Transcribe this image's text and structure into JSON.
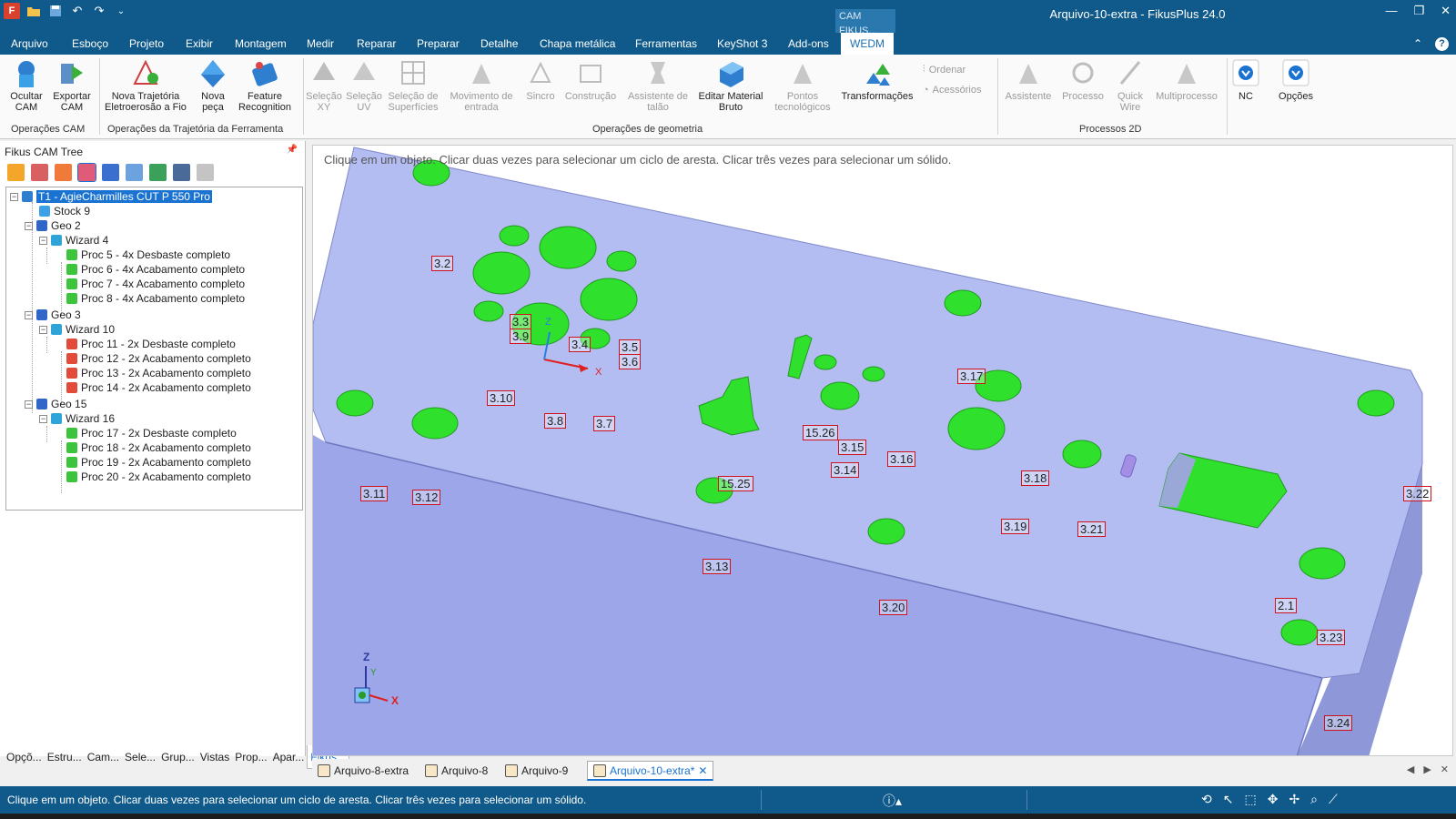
{
  "app": {
    "window_title": "Arquivo-10-extra - FikusPlus 24.0",
    "context_tab_title": "CAM FIKUS...",
    "colors": {
      "titlebar": "#0f5a8a",
      "part_face": "#b9c3f0",
      "feature_green": "#2fe02c",
      "label_border": "#d0121b",
      "selection": "#1a73d1"
    }
  },
  "quick_access": {
    "icons": [
      "app-logo-icon",
      "open-folder-icon",
      "save-icon",
      "undo-icon",
      "redo-icon",
      "customize-icon"
    ],
    "app_logo_text": "F"
  },
  "menu": {
    "items": [
      "Arquivo",
      "Esboço",
      "Projeto",
      "Exibir",
      "Montagem",
      "Medir",
      "Reparar",
      "Preparar",
      "Detalhe",
      "Chapa metálica",
      "Ferramentas",
      "KeyShot 3",
      "Add-ons",
      "WEDM"
    ],
    "active": "WEDM",
    "help": "?"
  },
  "ribbon": {
    "buttons": [
      {
        "id": "ocultar",
        "label": "Ocultar CAM",
        "icon": "hide-cam-icon",
        "enabled": true
      },
      {
        "id": "exportar",
        "label": "Exportar CAM",
        "icon": "export-cam-icon",
        "enabled": true
      },
      {
        "id": "nova-trajetoria",
        "label": "Nova Trajetória Eletroerosão a Fio",
        "icon": "new-toolpath-icon",
        "enabled": true
      },
      {
        "id": "nova-peca",
        "label": "Nova peça",
        "icon": "new-part-icon",
        "enabled": true
      },
      {
        "id": "feature",
        "label": "Feature Recognition",
        "icon": "feature-recognition-icon",
        "enabled": true
      },
      {
        "id": "selecao-xy",
        "label": "Seleção XY",
        "icon": "select-xy-icon",
        "enabled": false
      },
      {
        "id": "selecao-uv",
        "label": "Seleção UV",
        "icon": "select-uv-icon",
        "enabled": false
      },
      {
        "id": "selecao-sup",
        "label": "Seleção de Superfícies",
        "icon": "select-surfaces-icon",
        "enabled": false
      },
      {
        "id": "movimento",
        "label": "Movimento de entrada",
        "icon": "lead-in-icon",
        "enabled": false
      },
      {
        "id": "sincro",
        "label": "Sincro",
        "icon": "sync-icon",
        "enabled": false
      },
      {
        "id": "construcao",
        "label": "Construção",
        "icon": "construction-icon",
        "enabled": false
      },
      {
        "id": "assistente-talao",
        "label": "Assistente de talão",
        "icon": "slug-assistant-icon",
        "enabled": false
      },
      {
        "id": "editar-material",
        "label": "Editar Material Bruto",
        "icon": "edit-stock-icon",
        "enabled": true
      },
      {
        "id": "pontos",
        "label": "Pontos tecnológicos",
        "icon": "tech-points-icon",
        "enabled": false
      },
      {
        "id": "transformacoes",
        "label": "Transformações",
        "icon": "transformations-icon",
        "enabled": true
      },
      {
        "id": "assistente",
        "label": "Assistente",
        "icon": "assistant-icon",
        "enabled": false
      },
      {
        "id": "processo",
        "label": "Processo",
        "icon": "process-icon",
        "enabled": false
      },
      {
        "id": "quick-wire",
        "label": "Quick Wire",
        "icon": "quick-wire-icon",
        "enabled": false
      },
      {
        "id": "multiprocesso",
        "label": "Multiprocesso",
        "icon": "multiprocess-icon",
        "enabled": false
      },
      {
        "id": "nc",
        "label": "NC",
        "icon": "nc-download-icon",
        "enabled": true
      },
      {
        "id": "opcoes",
        "label": "Opções",
        "icon": "options-download-icon",
        "enabled": true
      }
    ],
    "small_buttons": {
      "ordenar": "Ordenar",
      "acessorios": "Acessórios"
    },
    "groups": {
      "operacoes_cam": "Operações CAM",
      "operacoes_trajetoria": "Operações da Trajetória da Ferramenta",
      "operacoes_geometria": "Operações de geometria",
      "processos_2d": "Processos 2D"
    }
  },
  "left_panel": {
    "title": "Fikus CAM Tree",
    "tools": [
      "machine-icon",
      "toolpath-icon",
      "stock-box-icon",
      "geometry-box-icon",
      "wizard-icon",
      "copy-icon",
      "layers-icon",
      "filter-icon",
      "settings-disabled-icon"
    ],
    "tree": {
      "root": "T1 - AgieCharmilles CUT P 550 Pro",
      "stock": "Stock 9",
      "geos": [
        {
          "name": "Geo 2",
          "wizard": "Wizard 4",
          "procs": [
            "Proc 5 - 4x Desbaste completo",
            "Proc 6 - 4x Acabamento completo",
            "Proc 7 - 4x Acabamento completo",
            "Proc 8 - 4x Acabamento completo"
          ]
        },
        {
          "name": "Geo 3",
          "wizard": "Wizard 10",
          "procs": [
            "Proc 11 - 2x Desbaste completo",
            "Proc 12 - 2x Acabamento completo",
            "Proc 13 - 2x Acabamento completo",
            "Proc 14 - 2x Acabamento completo"
          ]
        },
        {
          "name": "Geo 15",
          "wizard": "Wizard 16",
          "procs": [
            "Proc 17 - 2x Desbaste completo",
            "Proc 18 - 2x Acabamento completo",
            "Proc 19 - 2x Acabamento completo",
            "Proc 20 - 2x Acabamento completo"
          ]
        }
      ]
    },
    "tabs": [
      "Opçõ...",
      "Estru...",
      "Cam...",
      "Sele...",
      "Grup...",
      "Vistas",
      "Prop...",
      "Apar...",
      "Fikus..."
    ],
    "active_tab": "Fikus..."
  },
  "viewport": {
    "hint": "Clique em um objeto. Clicar duas vezes para selecionar um ciclo de aresta. Clicar três vezes para selecionar um sólido.",
    "labels": [
      "3.2",
      "3.3",
      "3.9",
      "3.4",
      "3.5",
      "3.6",
      "3.10",
      "3.8",
      "3.7",
      "15.26",
      "3.15",
      "3.14",
      "3.16",
      "3.17",
      "3.18",
      "3.11",
      "3.12",
      "15.25",
      "3.13",
      "3.19",
      "3.21",
      "3.20",
      "3.22",
      "2.1",
      "3.23",
      "3.24"
    ],
    "axes": {
      "x": "X",
      "y": "Y",
      "z": "Z"
    }
  },
  "doc_tabs": {
    "items": [
      "Arquivo-8-extra",
      "Arquivo-8",
      "Arquivo-9",
      "Arquivo-10-extra*"
    ],
    "active": "Arquivo-10-extra*",
    "close": "✕"
  },
  "status": {
    "text": "Clique em um objeto. Clicar duas vezes para selecionar um ciclo de aresta. Clicar três vezes para selecionar um sólido.",
    "icons": [
      "info-icon",
      "rotate-icon",
      "pointer-icon",
      "box-select-icon",
      "pan-icon",
      "move-icon",
      "zoom-icon",
      "measure-icon"
    ]
  }
}
